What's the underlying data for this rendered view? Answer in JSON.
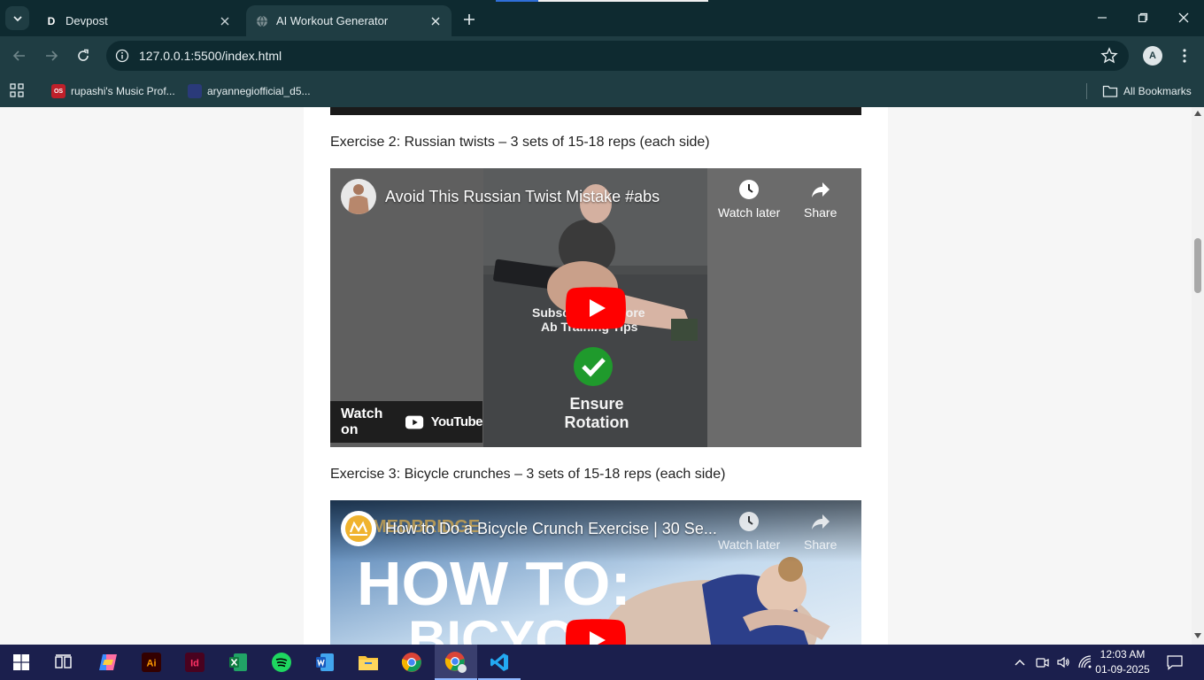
{
  "browser": {
    "tabs": [
      {
        "label": "Devpost",
        "favicon": "D"
      },
      {
        "label": "AI Workout Generator",
        "favicon": ""
      }
    ],
    "url": "127.0.0.1:5500/index.html",
    "profile_initial": "A",
    "bookmarks": [
      {
        "label": "rupashi's Music Prof...",
        "icon": "OS",
        "color": "#c0202a"
      },
      {
        "label": "aryannegiofficial_d5...",
        "icon": "",
        "color": "#2a3a7a"
      }
    ],
    "all_bookmarks": "All Bookmarks"
  },
  "page": {
    "exercises": [
      {
        "text": "Exercise 2: Russian twists – 3 sets of 15-18 reps (each side)",
        "video": {
          "title": "Avoid This Russian Twist Mistake #abs",
          "watch_later": "Watch later",
          "share": "Share",
          "overlay_top": "Subscribe for More",
          "overlay_bottom": "Ab Training Tips",
          "caption_line1": "Ensure",
          "caption_line2": "Rotation",
          "watch_on": "Watch on",
          "youtube": "YouTube"
        }
      },
      {
        "text": "Exercise 3: Bicycle crunches – 3 sets of 15-18 reps (each side)",
        "video": {
          "title": "How to Do a Bicycle Crunch Exercise | 30 Se...",
          "watch_later": "Watch later",
          "share": "Share",
          "brand": "MEDBRIDGE",
          "headline": "HOW TO:",
          "subheadline": "BICYCL"
        }
      }
    ]
  },
  "taskbar": {
    "time": "12:03 AM",
    "date": "01-09-2025",
    "apps": [
      "start-icon",
      "task-view-icon",
      "copilot-icon",
      "illustrator-icon",
      "indesign-icon",
      "excel-icon",
      "spotify-icon",
      "word-icon",
      "file-explorer-icon",
      "chrome-icon",
      "chrome-profile-icon",
      "vscode-icon"
    ],
    "app_labels": {
      "illustrator": "Ai",
      "indesign": "Id"
    }
  },
  "colors": {
    "tabstrip": "#0e2a30",
    "toolbar": "#1f3d43",
    "youtube_red": "#ff0000",
    "taskbar": "#1b1f4d"
  }
}
